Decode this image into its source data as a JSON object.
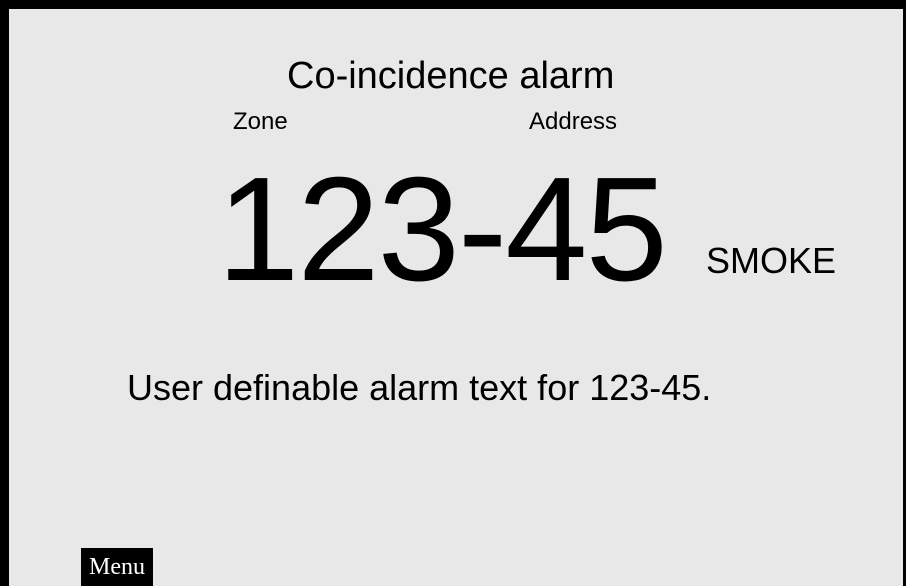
{
  "alarm": {
    "title": "Co-incidence alarm",
    "zone_label": "Zone",
    "address_label": "Address",
    "zone_address": "123-45",
    "detector_type": "SMOKE",
    "user_text": "User definable alarm text for 123-45."
  },
  "softkeys": {
    "menu_label": "Menu"
  },
  "colors": {
    "background": "#e8e8e8",
    "frame": "#000000",
    "text": "#000000",
    "softkey_background": "#000000",
    "softkey_text": "#ffffff"
  }
}
